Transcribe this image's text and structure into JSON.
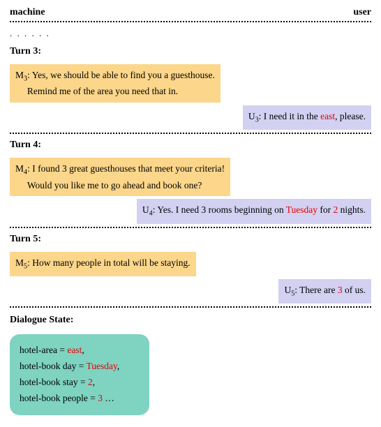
{
  "header": {
    "left": "machine",
    "right": "user"
  },
  "ellipsis": ". . .   . . .",
  "turns": {
    "t3": {
      "label": "Turn 3:",
      "m_prefix": "M",
      "m_sub": "3",
      "m_text": ": Yes, we should be able to find you a guesthouse.",
      "m_text2": "Remind me of the area you need that in.",
      "u_prefix": "U",
      "u_sub": "3",
      "u_a": ": I need it in the ",
      "u_hl": "east",
      "u_b": ", please."
    },
    "t4": {
      "label": "Turn 4:",
      "m_prefix": "M",
      "m_sub": "4",
      "m_text": ": I found 3 great guesthouses that meet your criteria!",
      "m_text2": "Would you like me to go ahead and book one?",
      "u_prefix": "U",
      "u_sub": "4",
      "u_a": ": Yes. I need 3 rooms beginning on ",
      "u_hl1": "Tuesday",
      "u_mid": " for ",
      "u_hl2": "2",
      "u_b": " nights."
    },
    "t5": {
      "label": "Turn 5:",
      "m_prefix": "M",
      "m_sub": "5",
      "m_text": ": How many people in total will be staying.",
      "u_prefix": "U",
      "u_sub": "5",
      "u_a": ": There are ",
      "u_hl": "3",
      "u_b": " of us."
    }
  },
  "dialogue_state_label": "Dialogue State:",
  "state": {
    "l1a": "hotel-area = ",
    "l1hl": "east",
    "l1b": ",",
    "l2a": "hotel-book day = ",
    "l2hl": "Tuesday",
    "l2b": ",",
    "l3a": "hotel-book stay = ",
    "l3hl": "2",
    "l3b": ",",
    "l4a": "hotel-book people = ",
    "l4hl": "3",
    "l4b": " …"
  }
}
